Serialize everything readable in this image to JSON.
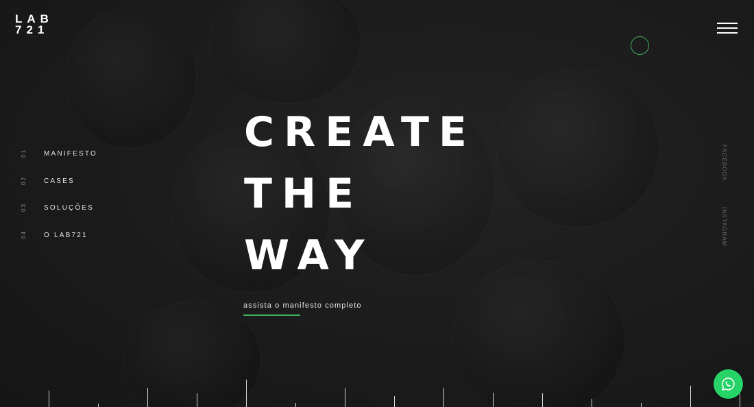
{
  "logo": {
    "line1": "LAB",
    "line2": "721"
  },
  "nav": {
    "items": [
      {
        "number": "01",
        "label": "MANIFESTO"
      },
      {
        "number": "02",
        "label": "CASES"
      },
      {
        "number": "03",
        "label": "SOLUÇÕES"
      },
      {
        "number": "04",
        "label": "O LAB721"
      }
    ]
  },
  "hero": {
    "line1": "CREATE",
    "line2": "THE",
    "line3": "WAY"
  },
  "manifest_link": "assista o manifesto completo",
  "social": {
    "facebook": "FACEBOOK",
    "instagram": "INSTAGRAM"
  },
  "icons": {
    "menu": "hamburger-menu-icon",
    "ring": "circle-outline-icon",
    "whatsapp": "whatsapp-icon"
  },
  "colors": {
    "background": "#1a1a1a",
    "accent_green": "#41b05b",
    "whatsapp_green": "#25d366",
    "text": "#ffffff"
  }
}
